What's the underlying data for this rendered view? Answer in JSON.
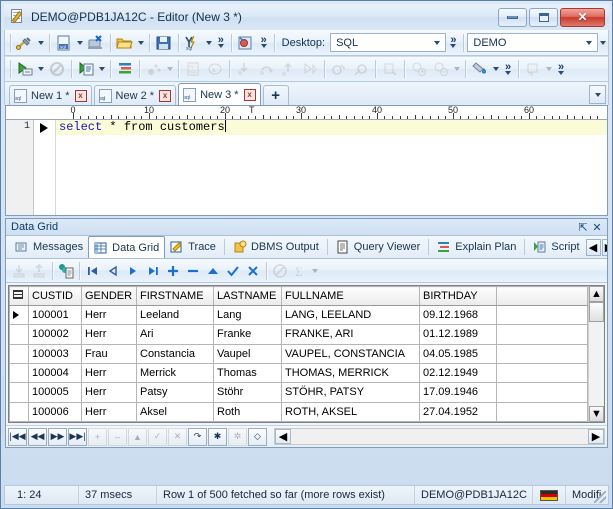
{
  "window": {
    "title": "DEMO@PDB1JA12C - Editor (New 3 *)",
    "icon": "editor-document-pencil-icon",
    "controls": {
      "minimize": "–",
      "maximize": "□",
      "close": "✕"
    }
  },
  "toolbar_main": {
    "buttons": [
      {
        "name": "new-connection-button",
        "icon": "plug-icon",
        "dropdown": true
      },
      {
        "name": "new-sql-window-button",
        "icon": "sql-document-icon",
        "dropdown": true
      },
      {
        "name": "disconnect-button",
        "icon": "disconnect-icon",
        "dropdown": false
      },
      {
        "name": "open-file-button",
        "icon": "folder-open-icon",
        "dropdown": true
      },
      {
        "name": "save-file-button",
        "icon": "floppy-save-icon",
        "dropdown": false
      },
      {
        "name": "format-sql-button",
        "icon": "sql-format-icon",
        "dropdown": true
      },
      {
        "name": "overflow-more-button",
        "icon": "chevron-double-right-icon",
        "dropdown": false
      },
      {
        "name": "session-browser-button",
        "icon": "session-browser-icon",
        "dropdown": false
      },
      {
        "name": "overflow-more-button-2",
        "icon": "chevron-double-right-icon",
        "dropdown": false
      }
    ],
    "desktop_label": "Desktop:",
    "desktop_value": "SQL",
    "connection_value": "DEMO"
  },
  "toolbar_secondary": {
    "buttons": [
      {
        "name": "execute-statement-button",
        "icon": "run-statement-icon",
        "dropdown": true,
        "enabled": true
      },
      {
        "name": "stop-button",
        "icon": "stop-circle-icon",
        "dropdown": false,
        "enabled": false
      },
      {
        "name": "execute-script-button",
        "icon": "run-script-icon",
        "dropdown": true,
        "enabled": true
      },
      {
        "name": "explain-plan-button",
        "icon": "explain-plan-icon",
        "dropdown": false,
        "enabled": true
      },
      {
        "name": "debug-button",
        "icon": "debug-icon",
        "dropdown": true,
        "enabled": false
      },
      {
        "name": "compile-plsql-button",
        "icon": "plsql-compile-icon",
        "dropdown": false,
        "enabled": false
      },
      {
        "name": "variables-button",
        "icon": "variables-x-icon",
        "dropdown": false,
        "enabled": false
      },
      {
        "name": "step-into-button",
        "icon": "step-into-icon",
        "dropdown": false,
        "enabled": false
      },
      {
        "name": "step-over-button",
        "icon": "step-over-icon",
        "dropdown": false,
        "enabled": false
      },
      {
        "name": "step-out-button",
        "icon": "step-out-icon",
        "dropdown": false,
        "enabled": false
      },
      {
        "name": "run-to-cursor-button",
        "icon": "run-cursor-icon",
        "dropdown": false,
        "enabled": false
      },
      {
        "name": "breakpoint-button",
        "icon": "breakpoint-icon",
        "dropdown": false,
        "enabled": false
      },
      {
        "name": "breakpoint-remove-button",
        "icon": "breakpoint-remove-icon",
        "dropdown": false,
        "enabled": false
      },
      {
        "name": "watch-button",
        "icon": "watch-icon",
        "dropdown": false,
        "enabled": false
      },
      {
        "name": "trace-timing-button",
        "icon": "trace-timing-icon",
        "dropdown": false,
        "enabled": false
      },
      {
        "name": "trace-stats-button",
        "icon": "trace-stats-icon",
        "dropdown": true,
        "enabled": false
      },
      {
        "name": "beautifier-button",
        "icon": "paint-bucket-icon",
        "dropdown": true,
        "enabled": true
      },
      {
        "name": "overflow-more-button-3",
        "icon": "chevron-double-right-icon",
        "dropdown": false,
        "enabled": true
      },
      {
        "name": "report-button",
        "icon": "report-icon",
        "dropdown": true,
        "enabled": false
      },
      {
        "name": "overflow-more-button-4",
        "icon": "chevron-double-right-icon",
        "dropdown": false,
        "enabled": true
      }
    ]
  },
  "editor_tabs": {
    "items": [
      {
        "label": "New 1 *",
        "icon": "sql-file-icon",
        "close": "x",
        "active": false
      },
      {
        "label": "New 2 *",
        "icon": "sql-file-icon",
        "close": "x",
        "active": false
      },
      {
        "label": "New 3 *",
        "icon": "sql-file-icon",
        "close": "x",
        "active": true
      }
    ],
    "add_label": "+",
    "dropdown_icon": "chevron-down-icon"
  },
  "editor": {
    "ruler_ticks": [
      0,
      10,
      20,
      30,
      40,
      50,
      60
    ],
    "tab_stop_marker": "T",
    "line_number": "1",
    "code_keyword_1": "select",
    "code_mid": " * from ",
    "code_rest": "customers",
    "full_text": "select * from customers"
  },
  "dock": {
    "caption": "Data Grid",
    "pin_icon": "pin-icon",
    "close_icon": "close-icon",
    "tabs": [
      {
        "label": "Messages",
        "icon": "messages-icon",
        "active": false
      },
      {
        "label": "Data Grid",
        "icon": "data-grid-icon",
        "active": true
      },
      {
        "label": "Trace",
        "icon": "trace-pencil-icon",
        "active": false
      },
      {
        "label": "DBMS Output",
        "icon": "dbms-output-icon",
        "active": false
      },
      {
        "label": "Query Viewer",
        "icon": "query-viewer-icon",
        "active": false
      },
      {
        "label": "Explain Plan",
        "icon": "explain-plan-icon",
        "active": false
      },
      {
        "label": "Script ",
        "icon": "script-output-icon",
        "active": false
      }
    ],
    "nav_prev_icon": "chevron-left-icon",
    "nav_next_icon": "chevron-right-icon"
  },
  "grid_toolbar": {
    "buttons": [
      {
        "name": "fetch-all-button",
        "icon": "download-all-icon",
        "enabled": false
      },
      {
        "name": "export-button",
        "icon": "upload-icon",
        "enabled": false
      },
      {
        "name": "copy-to-clipboard-button",
        "icon": "copy-data-icon",
        "enabled": true
      },
      {
        "name": "first-record-button",
        "icon": "first-record-icon",
        "enabled": true
      },
      {
        "name": "prior-record-button",
        "icon": "prior-record-icon",
        "enabled": true
      },
      {
        "name": "next-record-button",
        "icon": "next-record-icon",
        "enabled": true
      },
      {
        "name": "last-record-button",
        "icon": "last-record-icon",
        "enabled": true
      },
      {
        "name": "insert-record-button",
        "icon": "plus-icon",
        "enabled": true
      },
      {
        "name": "delete-record-button",
        "icon": "minus-icon",
        "enabled": true
      },
      {
        "name": "edit-record-button",
        "icon": "triangle-up-icon",
        "enabled": true
      },
      {
        "name": "post-edit-button",
        "icon": "check-icon",
        "enabled": true
      },
      {
        "name": "cancel-edit-button",
        "icon": "cross-icon",
        "enabled": true
      },
      {
        "name": "refresh-button",
        "icon": "refresh-disabled-icon",
        "enabled": false
      },
      {
        "name": "sum-button",
        "icon": "sigma-icon",
        "enabled": false,
        "dropdown": true
      }
    ]
  },
  "data_grid": {
    "columns": [
      "CUSTID",
      "GENDER",
      "FIRSTNAME",
      "LASTNAME",
      "FULLNAME",
      "BIRTHDAY",
      ""
    ],
    "rows": [
      {
        "selected": true,
        "CUSTID": "100001",
        "GENDER": "Herr",
        "FIRSTNAME": "Leeland",
        "LASTNAME": "Lang",
        "FULLNAME": "LANG, LEELAND",
        "BIRTHDAY": "09.12.1968"
      },
      {
        "selected": false,
        "CUSTID": "100002",
        "GENDER": "Herr",
        "FIRSTNAME": "Ari",
        "LASTNAME": "Franke",
        "FULLNAME": "FRANKE, ARI",
        "BIRTHDAY": "01.12.1989"
      },
      {
        "selected": false,
        "CUSTID": "100003",
        "GENDER": "Frau",
        "FIRSTNAME": "Constancia",
        "LASTNAME": "Vaupel",
        "FULLNAME": "VAUPEL, CONSTANCIA",
        "BIRTHDAY": "04.05.1985"
      },
      {
        "selected": false,
        "CUSTID": "100004",
        "GENDER": "Herr",
        "FIRSTNAME": "Merrick",
        "LASTNAME": "Thomas",
        "FULLNAME": "THOMAS, MERRICK",
        "BIRTHDAY": "02.12.1949"
      },
      {
        "selected": false,
        "CUSTID": "100005",
        "GENDER": "Herr",
        "FIRSTNAME": "Patsy",
        "LASTNAME": "Stöhr",
        "FULLNAME": "STÖHR, PATSY",
        "BIRTHDAY": "17.09.1946"
      },
      {
        "selected": false,
        "CUSTID": "100006",
        "GENDER": "Herr",
        "FIRSTNAME": "Aksel",
        "LASTNAME": "Roth",
        "FULLNAME": "ROTH, AKSEL",
        "BIRTHDAY": "27.04.1952"
      }
    ]
  },
  "grid_nav": {
    "buttons": [
      {
        "name": "nav-first-button",
        "icon": "first-icon",
        "glyph": "|◀◀"
      },
      {
        "name": "nav-prior-page-button",
        "icon": "prior-page-icon",
        "glyph": "◀◀"
      },
      {
        "name": "nav-next-page-button",
        "icon": "next-page-icon",
        "glyph": "▶▶"
      },
      {
        "name": "nav-last-button",
        "icon": "last-icon",
        "glyph": "▶▶|"
      },
      {
        "name": "nav-insert-button",
        "icon": "plus-icon",
        "glyph": "+"
      },
      {
        "name": "nav-delete-button",
        "icon": "minus-icon",
        "glyph": "–"
      },
      {
        "name": "nav-edit-button",
        "icon": "triangle-up-icon",
        "glyph": "▲"
      },
      {
        "name": "nav-post-button",
        "icon": "check-icon",
        "glyph": "✓"
      },
      {
        "name": "nav-cancel-button",
        "icon": "cross-icon",
        "glyph": "✕"
      },
      {
        "name": "nav-refresh-button",
        "icon": "refresh-arrow-icon",
        "glyph": "↷"
      },
      {
        "name": "nav-asterisk-button",
        "icon": "asterisk-icon",
        "glyph": "✱"
      },
      {
        "name": "nav-asterisk-alt-button",
        "icon": "asterisk-small-icon",
        "glyph": "✲"
      },
      {
        "name": "nav-clear-filter-button",
        "icon": "eraser-icon",
        "glyph": "◇"
      }
    ],
    "hscroll_left_icon": "triangle-left-icon",
    "hscroll_right_icon": "triangle-right-icon"
  },
  "statusbar": {
    "cursor_position": "1:  24",
    "elapsed": "37 msecs",
    "row_status": "Row 1 of 500 fetched so far (more rows exist)",
    "connection": "DEMO@PDB1JA12C",
    "flag_icon": "germany-flag-icon",
    "modified": "Modifi"
  },
  "colors": {
    "accent": "#2b4b6f",
    "keyword": "#1414c8",
    "code_line_bg": "#fbfbd8",
    "titlebar": "#dbe8f6",
    "close_button": "#c8392c"
  }
}
